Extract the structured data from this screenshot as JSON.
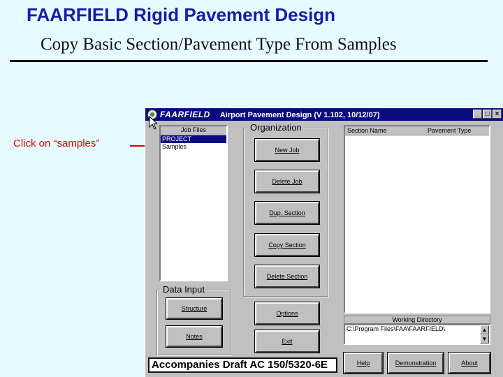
{
  "slide": {
    "title": "FAARFIELD Rigid Pavement Design",
    "subtitle": "Copy Basic Section/Pavement Type From Samples",
    "callout": "Click on “samples”",
    "caption": "Accompanies Draft AC 150/5320-6E"
  },
  "window": {
    "app_name": "FAARFIELD",
    "subtitle": "Airport Pavement Design (V 1.102, 10/12/07)",
    "controls": {
      "minimize": "_",
      "maximize": "□",
      "close": "×"
    }
  },
  "job_files": {
    "header": "Job Files",
    "items": [
      "PROJECT",
      "Samples"
    ],
    "selected_index": 0
  },
  "organization": {
    "label": "Organization",
    "buttons": {
      "new_job": "New Job",
      "delete_job": "Delete Job",
      "dup_section": "Dup. Section",
      "copy_section": "Copy Section",
      "delete_section": "Delete Section"
    }
  },
  "data_input": {
    "label": "Data Input",
    "buttons": {
      "structure": "Structure",
      "notes": "Notes"
    }
  },
  "sections": {
    "col_section": "Section Name",
    "col_pavement": "Pavement Type"
  },
  "working_directory": {
    "label": "Working Directory",
    "path": "C:\\Program Files\\FAA\\FAARFIELD\\"
  },
  "bottom_buttons": {
    "options": "Options",
    "exit": "Exit",
    "help": "Help",
    "demonstration": "Demonstration",
    "about": "About"
  },
  "colors": {
    "title_blue": "#1a1aa6",
    "callout_red": "#e00000",
    "titlebar_navy": "#0a0a80",
    "window_gray": "#c0c0c0",
    "slide_bg": "#e5fbff"
  }
}
